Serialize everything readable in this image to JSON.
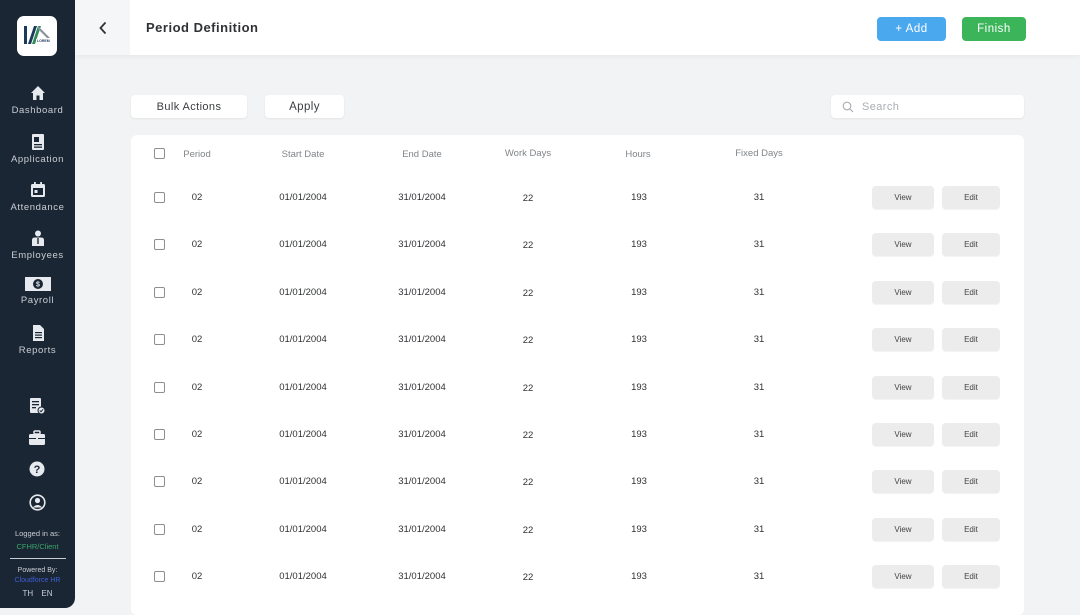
{
  "sidebar": {
    "logo_text": "LOREM",
    "nav": [
      {
        "label": "Dashboard",
        "icon": "home-icon"
      },
      {
        "label": "Application",
        "icon": "document-icon"
      },
      {
        "label": "Attendance",
        "icon": "calendar-icon"
      },
      {
        "label": "Employees",
        "icon": "person-icon"
      },
      {
        "label": "Payroll",
        "icon": "dollar-bill-icon"
      },
      {
        "label": "Reports",
        "icon": "report-icon"
      }
    ],
    "utility_icons": [
      "checklist-icon",
      "briefcase-icon",
      "help-icon",
      "user-circle-icon"
    ],
    "logged_in_label": "Logged in as:",
    "logged_in_user": "CFHR/Client",
    "powered_by_label": "Powered By:",
    "powered_by_brand": "Cloudforce HR",
    "languages": [
      "TH",
      "EN"
    ]
  },
  "header": {
    "title": "Period Definition",
    "add_label": "+ Add",
    "finish_label": "Finish"
  },
  "toolbar": {
    "bulk_actions_label": "Bulk Actions",
    "apply_label": "Apply",
    "search_placeholder": "Search",
    "search_value": ""
  },
  "table": {
    "columns": [
      "Period",
      "Start Date",
      "End Date",
      "Work Days",
      "Hours",
      "Fixed Days"
    ],
    "view_label": "View",
    "edit_label": "Edit",
    "rows": [
      {
        "period": "02",
        "start_date": "01/01/2004",
        "end_date": "31/01/2004",
        "work_days": "22",
        "hours": "193",
        "fixed_days": "31"
      },
      {
        "period": "02",
        "start_date": "01/01/2004",
        "end_date": "31/01/2004",
        "work_days": "22",
        "hours": "193",
        "fixed_days": "31"
      },
      {
        "period": "02",
        "start_date": "01/01/2004",
        "end_date": "31/01/2004",
        "work_days": "22",
        "hours": "193",
        "fixed_days": "31"
      },
      {
        "period": "02",
        "start_date": "01/01/2004",
        "end_date": "31/01/2004",
        "work_days": "22",
        "hours": "193",
        "fixed_days": "31"
      },
      {
        "period": "02",
        "start_date": "01/01/2004",
        "end_date": "31/01/2004",
        "work_days": "22",
        "hours": "193",
        "fixed_days": "31"
      },
      {
        "period": "02",
        "start_date": "01/01/2004",
        "end_date": "31/01/2004",
        "work_days": "22",
        "hours": "193",
        "fixed_days": "31"
      },
      {
        "period": "02",
        "start_date": "01/01/2004",
        "end_date": "31/01/2004",
        "work_days": "22",
        "hours": "193",
        "fixed_days": "31"
      },
      {
        "period": "02",
        "start_date": "01/01/2004",
        "end_date": "31/01/2004",
        "work_days": "22",
        "hours": "193",
        "fixed_days": "31"
      },
      {
        "period": "02",
        "start_date": "01/01/2004",
        "end_date": "31/01/2004",
        "work_days": "22",
        "hours": "193",
        "fixed_days": "31"
      }
    ]
  },
  "colors": {
    "sidebar_bg": "#1b2634",
    "add_button": "#4aa8ef",
    "finish_button": "#3bb45a",
    "logged_user": "#3aa66a",
    "powered_brand": "#3d5fd6"
  }
}
